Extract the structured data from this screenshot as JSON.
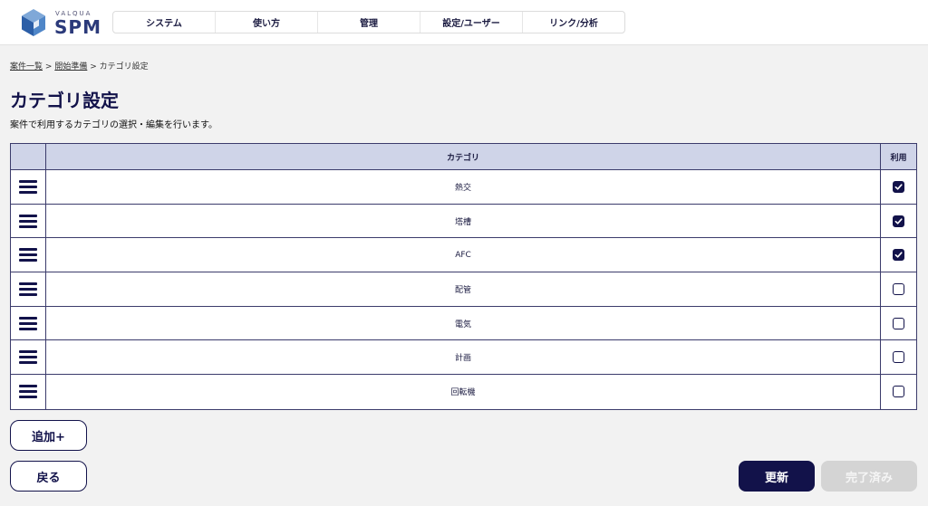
{
  "logo": {
    "brand_small": "VALQUA",
    "brand_big": "SPM"
  },
  "nav": {
    "items": [
      {
        "label": "システム"
      },
      {
        "label": "使い方"
      },
      {
        "label": "管理"
      },
      {
        "label": "設定/ユーザー"
      },
      {
        "label": "リンク/分析"
      }
    ]
  },
  "breadcrumb": {
    "items": [
      {
        "label": "案件一覧"
      },
      {
        "label": "開始準備"
      },
      {
        "label": "カテゴリ設定"
      }
    ],
    "separator": ">"
  },
  "page": {
    "title": "カテゴリ設定",
    "description": "案件で利用するカテゴリの選択・編集を行います。"
  },
  "table": {
    "headers": {
      "category": "カテゴリ",
      "use": "利用"
    },
    "rows": [
      {
        "name": "熱交",
        "checked": true
      },
      {
        "name": "塔槽",
        "checked": true
      },
      {
        "name": "AFC",
        "checked": true
      },
      {
        "name": "配管",
        "checked": false
      },
      {
        "name": "電気",
        "checked": false
      },
      {
        "name": "計画",
        "checked": false
      },
      {
        "name": "回転機",
        "checked": false
      }
    ]
  },
  "buttons": {
    "add": "追加+",
    "back": "戻る",
    "update": "更新",
    "done": "完了済み"
  },
  "colors": {
    "primary": "#12124a",
    "header_row": "#cfd4e8",
    "disabled": "#d4d4d4"
  },
  "icons": {
    "drag_handle": "hamburger-icon",
    "checked": "checkbox-checked-icon",
    "unchecked": "checkbox-unchecked-icon"
  }
}
